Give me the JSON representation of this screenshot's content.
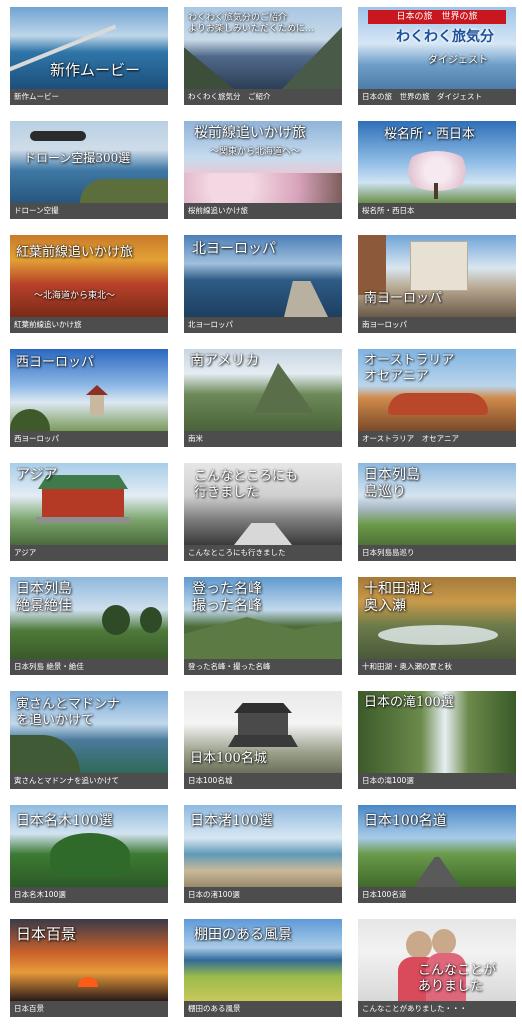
{
  "tiles": [
    {
      "title": "新作ムービー",
      "caption": "新作ムービー",
      "icon": "new-movie-thumbnail"
    },
    {
      "title": "わくわく旅気分のご紹介\nよりお楽しみいただくために…",
      "caption": "わくわく旅気分　ご紹介",
      "icon": "fjord-thumbnail"
    },
    {
      "title": "わくわく旅気分",
      "banner": "日本の旅　世界の旅",
      "subtitle": "ダイジェスト",
      "caption": "日本の旅　世界の旅　ダイジェスト",
      "icon": "digest-logo-thumbnail"
    },
    {
      "title": "ドローン空撮300選",
      "caption": "ドローン空撮",
      "icon": "drone-thumbnail"
    },
    {
      "title": "桜前線追いかけ旅",
      "subtitle": "〜関東から北海道へ〜",
      "caption": "桜前線追いかけ旅",
      "icon": "cherry-blossom-thumbnail"
    },
    {
      "title": "桜名所・西日本",
      "caption": "桜名所・西日本",
      "icon": "sakura-tree-thumbnail"
    },
    {
      "title": "紅葉前線追いかけ旅",
      "subtitle": "〜北海道から東北〜",
      "caption": "紅葉前線追いかけ旅",
      "icon": "autumn-leaves-thumbnail"
    },
    {
      "title": "北ヨーロッパ",
      "caption": "北ヨーロッパ",
      "icon": "lake-boat-thumbnail"
    },
    {
      "title": "南ヨーロッパ",
      "caption": "南ヨーロッパ",
      "icon": "spanish-steps-thumbnail"
    },
    {
      "title": "西ヨーロッパ",
      "caption": "西ヨーロッパ",
      "icon": "windmill-thumbnail"
    },
    {
      "title": "南アメリカ",
      "caption": "南米",
      "icon": "machu-picchu-thumbnail"
    },
    {
      "title": "オーストラリア\nオセアニア",
      "caption": "オーストラリア　オセアニア",
      "icon": "uluru-thumbnail"
    },
    {
      "title": "アジア",
      "caption": "アジア",
      "icon": "temple-thumbnail"
    },
    {
      "title": "こんなところにも\n行きました",
      "caption": "こんなところにも行きました",
      "icon": "snow-shrine-thumbnail"
    },
    {
      "title": "日本列島\n島巡り",
      "caption": "日本列島島巡り",
      "icon": "island-thumbnail"
    },
    {
      "title": "日本列島\n絶景絶佳",
      "caption": "日本列島 絶景・絶佳",
      "icon": "trees-thumbnail"
    },
    {
      "title": "登った名峰\n撮った名峰",
      "caption": "登った名峰・撮った名峰",
      "icon": "mountain-thumbnail"
    },
    {
      "title": "十和田湖と\n奥入瀬",
      "caption": "十和田湖・奥入瀬の夏と秋",
      "icon": "stream-thumbnail"
    },
    {
      "title": "寅さんとマドンナ\nを追いかけて",
      "caption": "寅さんとマドンナを追いかけて",
      "icon": "bay-thumbnail"
    },
    {
      "title": "日本100名城",
      "caption": "日本100名城",
      "icon": "castle-thumbnail"
    },
    {
      "title": "日本の滝100選",
      "caption": "日本の滝100選",
      "icon": "waterfall-thumbnail"
    },
    {
      "title": "日本名木100選",
      "caption": "日本名木100選",
      "icon": "big-tree-thumbnail"
    },
    {
      "title": "日本渚100選",
      "caption": "日本の渚100選",
      "icon": "beach-thumbnail"
    },
    {
      "title": "日本100名道",
      "caption": "日本100名道",
      "icon": "road-thumbnail"
    },
    {
      "title": "日本百景",
      "caption": "日本百景",
      "icon": "sunset-thumbnail"
    },
    {
      "title": "棚田のある風景",
      "caption": "棚田のある風景",
      "icon": "rice-terrace-thumbnail"
    },
    {
      "title": "こんなことが\nありました",
      "caption": "こんなことがありました・・・",
      "icon": "couple-thumbnail"
    }
  ]
}
